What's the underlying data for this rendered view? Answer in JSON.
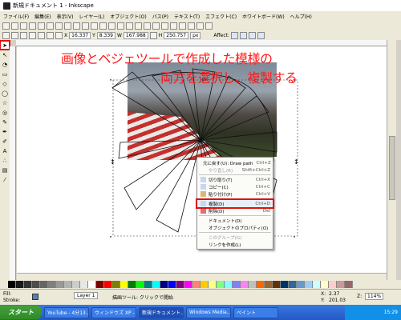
{
  "window": {
    "title": "新規ドキュメント 1 - Inkscape"
  },
  "menu": [
    "ファイル(F)",
    "編集(E)",
    "表示(V)",
    "レイヤー(L)",
    "オブジェクト(O)",
    "パス(P)",
    "テキスト(T)",
    "エフェクト(C)",
    "ホワイトボード(W)",
    "ヘルプ(H)"
  ],
  "controls": {
    "x_value": "16.337",
    "y_value": "8.339",
    "w_value": "167.988",
    "h_value": "250.757",
    "unit": "px",
    "affect_label": "Affect:"
  },
  "annotation": {
    "line1": "画像とベジェツールで作成した模様の",
    "line2": "両方を選択し、複製する"
  },
  "context_menu": {
    "items": [
      {
        "label": "元に戻す(U): Draw path",
        "shortcut": "Ctrl+Z",
        "disabled": false
      },
      {
        "label": "やり直し(R)",
        "shortcut": "Shift+Ctrl+Z",
        "disabled": true
      },
      {
        "label": "切り取り(T)",
        "shortcut": "Ctrl+X",
        "disabled": false
      },
      {
        "label": "コピー(C)",
        "shortcut": "Ctrl+C",
        "disabled": false
      },
      {
        "label": "貼り付け(P)",
        "shortcut": "Ctrl+V",
        "disabled": false
      },
      {
        "label": "複製(D)",
        "shortcut": "Ctrl+D",
        "disabled": false,
        "highlighted": true
      },
      {
        "label": "削除(D)",
        "shortcut": "Del",
        "disabled": false
      },
      {
        "label": "ドキュメント(D)",
        "shortcut": "",
        "disabled": false
      },
      {
        "label": "オブジェクトのプロパティ(O)",
        "shortcut": "",
        "disabled": false
      },
      {
        "label": "このグループ(G)",
        "shortcut": "",
        "disabled": true
      },
      {
        "label": "リンクを作成(L)",
        "shortcut": "",
        "disabled": false
      }
    ]
  },
  "status": {
    "fill_label": "Fill:",
    "stroke_label": "Stroke:",
    "layer": "Layer 1",
    "message": "描画ツール: クリックで開始",
    "x_label": "X:",
    "x_coord": "2.37",
    "y_label": "Y:",
    "y_coord": "201.03",
    "zoom_label": "Z:",
    "zoom": "114%"
  },
  "taskbar": {
    "start_label": "スタート",
    "tasks": [
      "YouTube - 4分13...",
      "ウィンドウズ XP - ...",
      "新規ドキュメント...",
      "Windows Media...",
      "ペイント"
    ],
    "clock": "15:29"
  },
  "palette": [
    "#000000",
    "#1a1a1a",
    "#333333",
    "#4d4d4d",
    "#666666",
    "#808080",
    "#999999",
    "#b3b3b3",
    "#cccccc",
    "#e6e6e6",
    "#ffffff",
    "#800000",
    "#ff0000",
    "#808000",
    "#ffff00",
    "#008000",
    "#00ff00",
    "#008080",
    "#00ffff",
    "#000080",
    "#0000ff",
    "#800080",
    "#ff00ff",
    "#ff8080",
    "#ffcc00",
    "#ffff80",
    "#80ff80",
    "#80ffff",
    "#8080ff",
    "#ff80ff",
    "#c0c0c0",
    "#ff6600",
    "#996633",
    "#663300",
    "#003366",
    "#336699",
    "#6699cc",
    "#99ccff",
    "#ccffff",
    "#ffffcc",
    "#ffcccc",
    "#cc9999",
    "#996666"
  ]
}
